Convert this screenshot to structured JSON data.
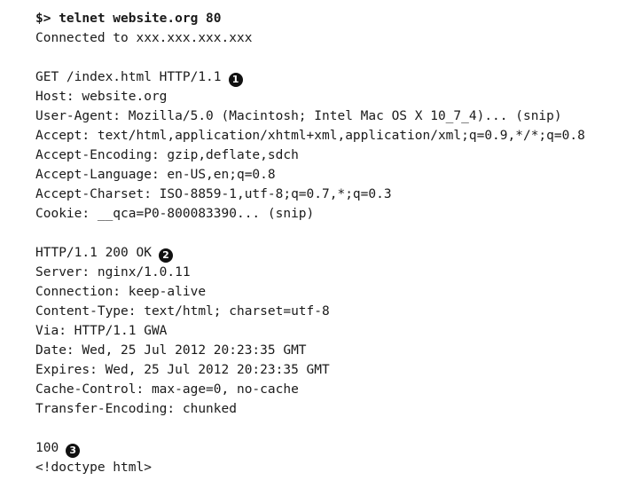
{
  "command": "$> telnet website.org 80",
  "connected": "Connected to xxx.xxx.xxx.xxx",
  "request": {
    "request_line": "GET /index.html HTTP/1.1",
    "callout": "1",
    "headers": [
      "Host: website.org",
      "User-Agent: Mozilla/5.0 (Macintosh; Intel Mac OS X 10_7_4)... (snip)",
      "Accept: text/html,application/xhtml+xml,application/xml;q=0.9,*/*;q=0.8",
      "Accept-Encoding: gzip,deflate,sdch",
      "Accept-Language: en-US,en;q=0.8",
      "Accept-Charset: ISO-8859-1,utf-8;q=0.7,*;q=0.3",
      "Cookie: __qca=P0-800083390... (snip)"
    ]
  },
  "response": {
    "status_line": "HTTP/1.1 200 OK",
    "callout": "2",
    "headers": [
      "Server: nginx/1.0.11",
      "Connection: keep-alive",
      "Content-Type: text/html; charset=utf-8",
      "Via: HTTP/1.1 GWA",
      "Date: Wed, 25 Jul 2012 20:23:35 GMT",
      "Expires: Wed, 25 Jul 2012 20:23:35 GMT",
      "Cache-Control: max-age=0, no-cache",
      "Transfer-Encoding: chunked"
    ]
  },
  "body": {
    "chunk_size": "100",
    "callout": "3",
    "first_line": "<!doctype html>"
  }
}
